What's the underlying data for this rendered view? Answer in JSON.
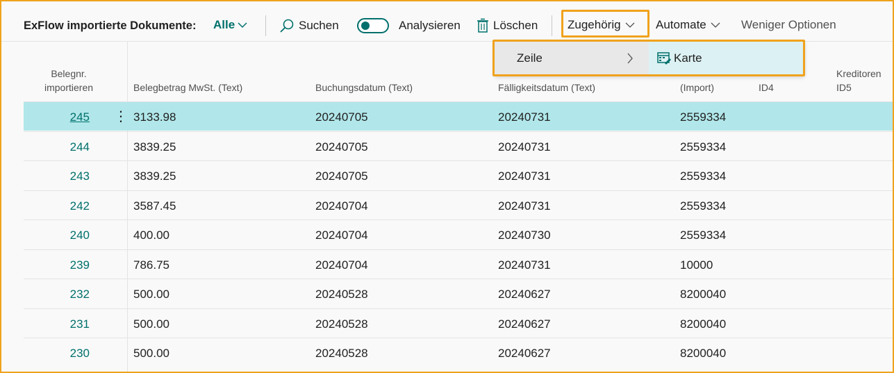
{
  "toolbar": {
    "title": "ExFlow importierte Dokumente:",
    "view": "Alle",
    "search": "Suchen",
    "analyze": "Analysieren",
    "delete": "Löschen",
    "related": "Zugehörig",
    "automate": "Automate",
    "fewer_options": "Weniger Optionen"
  },
  "menu": {
    "line": "Zeile",
    "card": "Karte"
  },
  "columns": {
    "doc_no": [
      "Belegnr.",
      "importieren"
    ],
    "vat_amount": "Belegbetrag MwSt. (Text)",
    "posting_date": "Buchungsdatum (Text)",
    "due_date": "Fälligkeitsdatum (Text)",
    "vendor_import": "(Import)",
    "vendor_id4": "ID4",
    "vendor_id5": [
      "Kreditoren",
      "ID5"
    ]
  },
  "rows": [
    {
      "no": "245",
      "amount": "3133.98",
      "posting": "20240705",
      "due": "20240731",
      "vendor": "2559334"
    },
    {
      "no": "244",
      "amount": "3839.25",
      "posting": "20240705",
      "due": "20240731",
      "vendor": "2559334"
    },
    {
      "no": "243",
      "amount": "3839.25",
      "posting": "20240705",
      "due": "20240731",
      "vendor": "2559334"
    },
    {
      "no": "242",
      "amount": "3587.45",
      "posting": "20240704",
      "due": "20240731",
      "vendor": "2559334"
    },
    {
      "no": "240",
      "amount": "400.00",
      "posting": "20240704",
      "due": "20240730",
      "vendor": "2559334"
    },
    {
      "no": "239",
      "amount": "786.75",
      "posting": "20240704",
      "due": "20240731",
      "vendor": "10000"
    },
    {
      "no": "232",
      "amount": "500.00",
      "posting": "20240528",
      "due": "20240627",
      "vendor": "8200040"
    },
    {
      "no": "231",
      "amount": "500.00",
      "posting": "20240528",
      "due": "20240627",
      "vendor": "8200040"
    },
    {
      "no": "230",
      "amount": "500.00",
      "posting": "20240528",
      "due": "20240627",
      "vendor": "8200040"
    }
  ],
  "colors": {
    "accent": "#00706c",
    "highlight": "#f0a21c",
    "selected_row": "#b1e7ea"
  }
}
